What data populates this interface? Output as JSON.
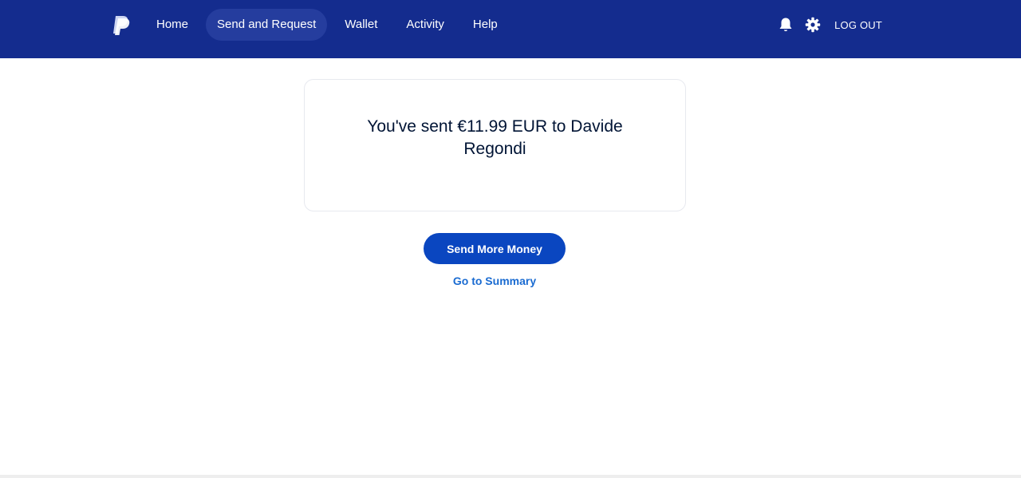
{
  "header": {
    "logo_icon": "paypal-logo-icon",
    "nav": [
      {
        "label": "Home",
        "active": false
      },
      {
        "label": "Send and Request",
        "active": true
      },
      {
        "label": "Wallet",
        "active": false
      },
      {
        "label": "Activity",
        "active": false
      },
      {
        "label": "Help",
        "active": false
      }
    ],
    "notifications_icon": "bell-icon",
    "settings_icon": "gear-icon",
    "logout_label": "LOG OUT"
  },
  "confirmation": {
    "message": "You've sent €11.99 EUR to Davide Regondi"
  },
  "actions": {
    "send_more_label": "Send More Money",
    "summary_link_label": "Go to Summary"
  },
  "colors": {
    "header_bg": "#142c8e",
    "active_tab_bg": "#253d9e",
    "primary_button": "#0a46c0",
    "link": "#1a6bd1",
    "text": "#001435"
  }
}
